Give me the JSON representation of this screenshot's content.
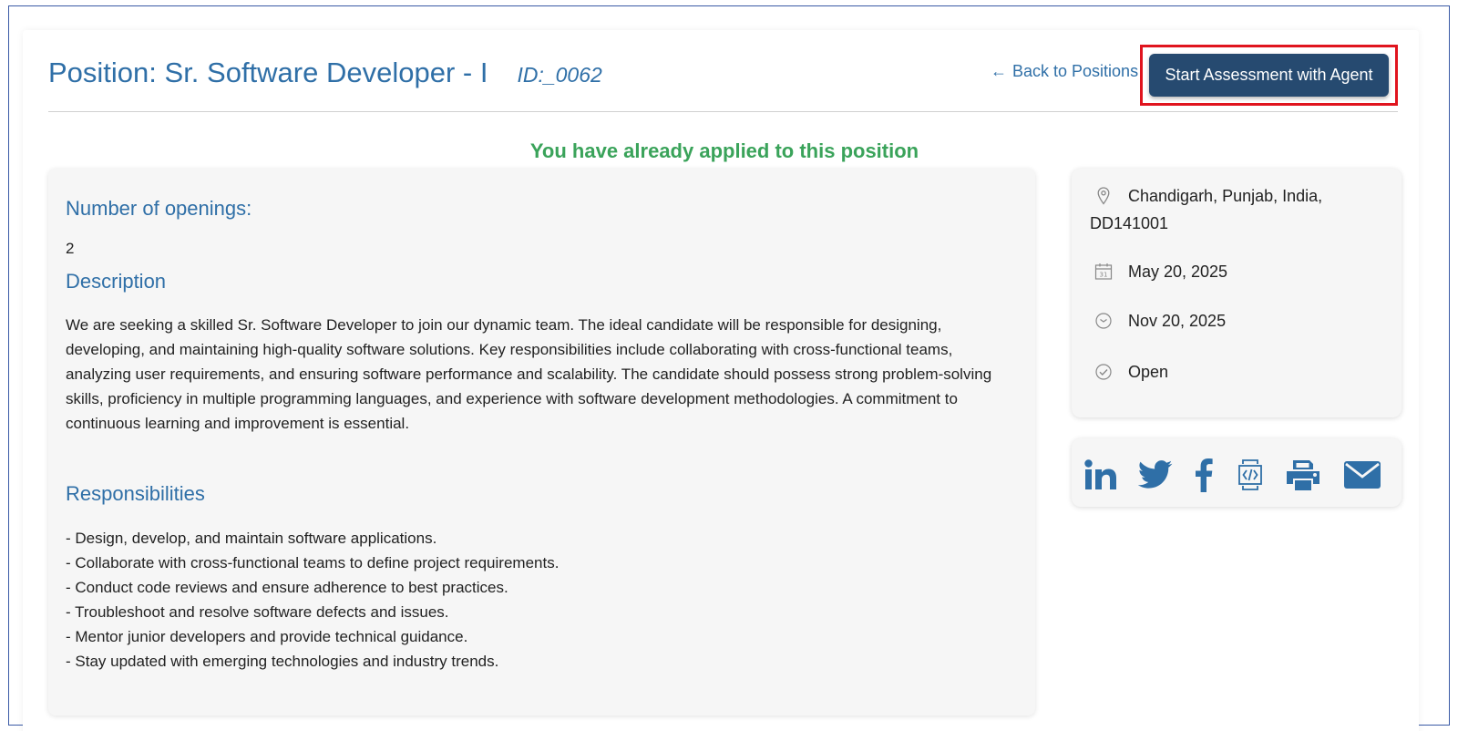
{
  "header": {
    "position_title": "Position: Sr. Software Developer - I",
    "position_id": "ID:_0062",
    "back_link": "Back to Positions",
    "agent_button": "Start Assessment with Agent"
  },
  "status_message": "You have already applied to this position",
  "details": {
    "openings_heading": "Number of openings:",
    "openings_value": "2",
    "description_heading": "Description",
    "description_text": "We are seeking a skilled Sr. Software Developer to join our dynamic team. The ideal candidate will be responsible for designing, developing, and maintaining high-quality software solutions. Key responsibilities include collaborating with cross-functional teams, analyzing user requirements, and ensuring software performance and scalability. The candidate should possess strong problem-solving skills, proficiency in multiple programming languages, and experience with software development methodologies. A commitment to continuous learning and improvement is essential.",
    "responsibilities_heading": "Responsibilities",
    "responsibilities": [
      "- Design, develop, and maintain software applications.",
      "- Collaborate with cross-functional teams to define project requirements.",
      "- Conduct code reviews and ensure adherence to best practices.",
      "- Troubleshoot and resolve software defects and issues.",
      "- Mentor junior developers and provide technical guidance.",
      "- Stay updated with emerging technologies and industry trends."
    ]
  },
  "info": {
    "location_line1": "Chandigarh, Punjab, India,",
    "location_line2": "DD141001",
    "start_date": "May 20, 2025",
    "end_date": "Nov 20, 2025",
    "status": "Open",
    "icons": [
      "location-pin-icon",
      "calendar-icon",
      "clock-icon",
      "check-circle-icon"
    ]
  },
  "share": {
    "icons": [
      "linkedin-icon",
      "twitter-icon",
      "facebook-icon",
      "embed-icon",
      "print-icon",
      "email-icon"
    ]
  },
  "colors": {
    "accent": "#2f6fa7",
    "button_bg": "#264a70",
    "success": "#3aa35a",
    "highlight": "#e0141e",
    "icon_blue": "#2f6fa7"
  }
}
